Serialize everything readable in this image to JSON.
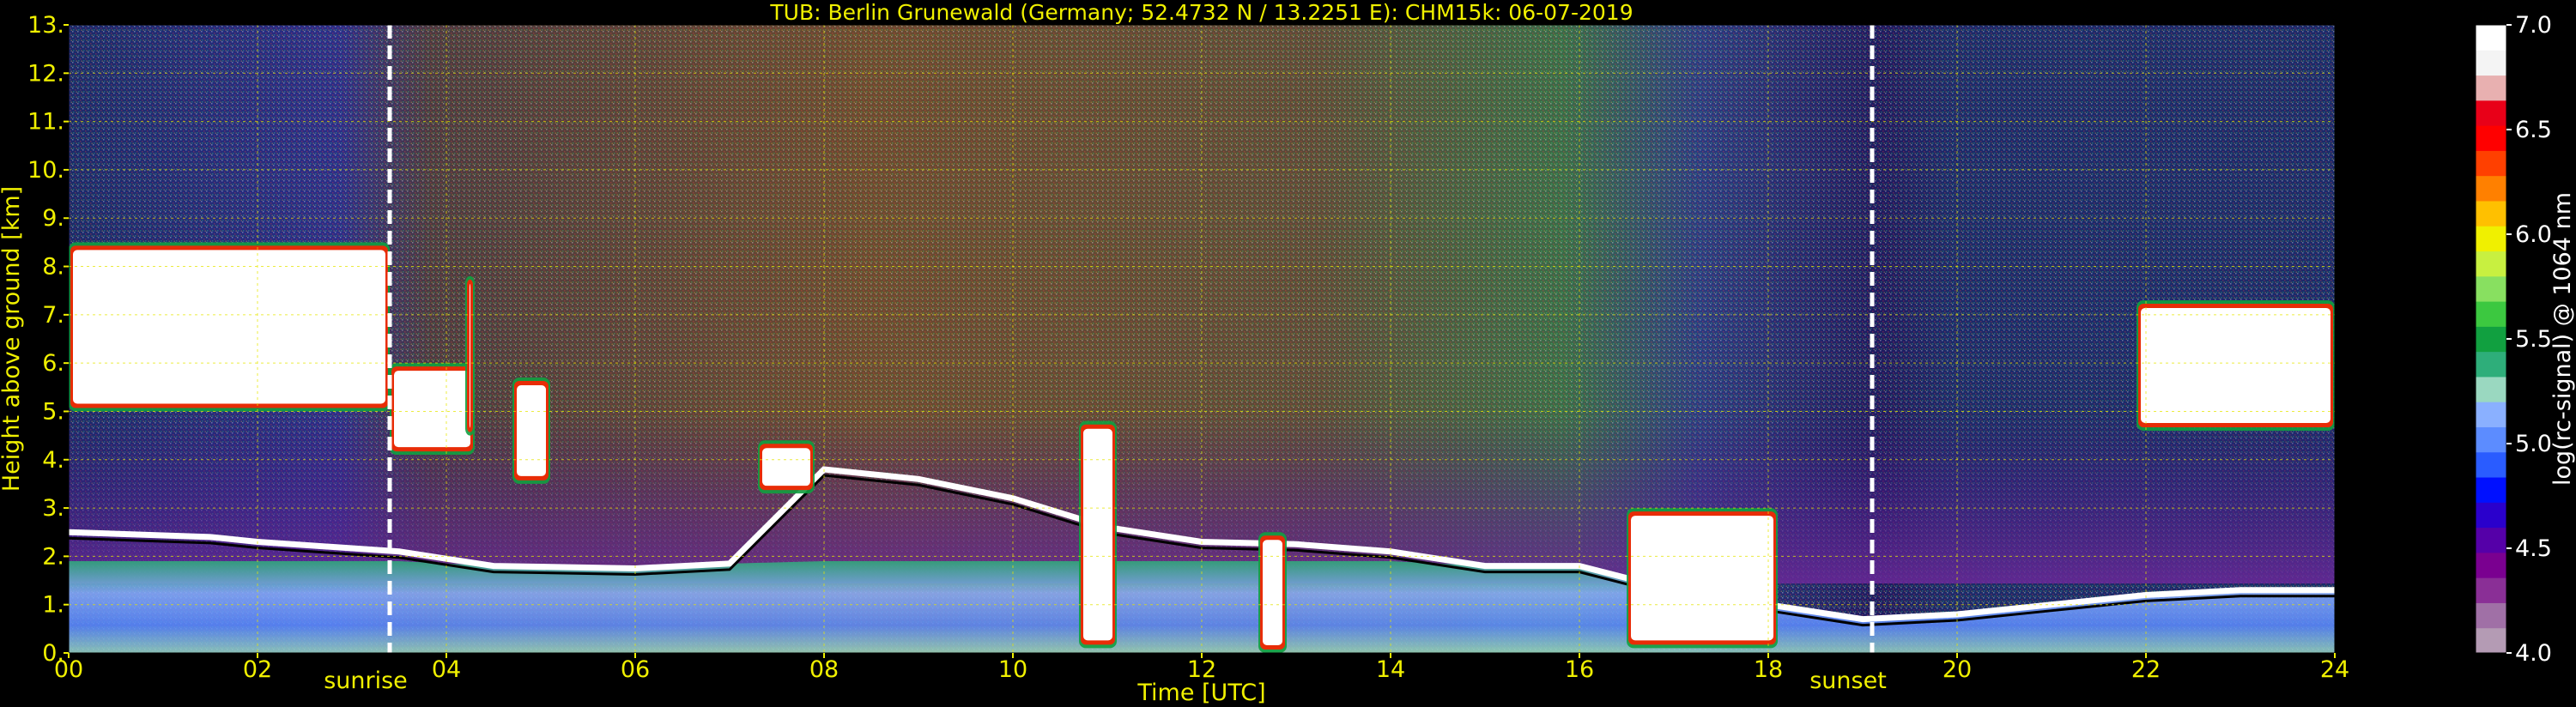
{
  "chart_data": {
    "type": "heatmap",
    "title": "TUB: Berlin Grunewald (Germany; 52.4732 N / 13.2251 E):    CHM15k: 06-07-2019",
    "xlabel": "Time [UTC]",
    "ylabel": "Height above ground [km]",
    "xlim": [
      0,
      24
    ],
    "ylim": [
      0,
      13
    ],
    "x_ticks": [
      "00",
      "02",
      "04",
      "06",
      "08",
      "10",
      "12",
      "14",
      "16",
      "18",
      "20",
      "22",
      "24"
    ],
    "y_ticks": [
      "0.",
      "1.",
      "2.",
      "3.",
      "4.",
      "5.",
      "6.",
      "7.",
      "8.",
      "9.",
      "10.",
      "11.",
      "12.",
      "13."
    ],
    "grid": true,
    "colorbar": {
      "label": "log(rc-signal) @ 1064 nm",
      "range": [
        4.0,
        7.0
      ],
      "ticks": [
        "4.0",
        "4.5",
        "5.0",
        "5.5",
        "6.0",
        "6.5",
        "7.0"
      ],
      "colors": [
        "#b49bb4",
        "#a070a6",
        "#8a2f96",
        "#7a0090",
        "#5500a8",
        "#2a00cc",
        "#0010ff",
        "#2a5cff",
        "#5c8cff",
        "#8ab0ff",
        "#9ad8c0",
        "#2eae7a",
        "#11a040",
        "#3cc840",
        "#88e060",
        "#c8f040",
        "#f0f000",
        "#ffc000",
        "#ff8000",
        "#ff4000",
        "#ff0000",
        "#e80018",
        "#e8b0b0",
        "#f4f4f4",
        "#ffffff"
      ]
    },
    "events": [
      {
        "label": "sunrise",
        "x": 3.4
      },
      {
        "label": "sunset",
        "x": 19.1
      }
    ],
    "cloud_layers": [
      {
        "x_start": 0.0,
        "x_end": 3.4,
        "y_bottom": 5.0,
        "y_top": 8.5,
        "intensity": "high"
      },
      {
        "x_start": 3.4,
        "x_end": 4.3,
        "y_bottom": 4.1,
        "y_top": 6.0,
        "intensity": "high"
      },
      {
        "x_start": 4.2,
        "x_end": 4.3,
        "y_bottom": 4.5,
        "y_top": 7.8,
        "intensity": "high"
      },
      {
        "x_start": 4.7,
        "x_end": 5.1,
        "y_bottom": 3.5,
        "y_top": 5.7,
        "intensity": "high"
      },
      {
        "x_start": 7.3,
        "x_end": 7.9,
        "y_bottom": 3.3,
        "y_top": 4.4,
        "intensity": "high"
      },
      {
        "x_start": 10.7,
        "x_end": 11.1,
        "y_bottom": 0.1,
        "y_top": 4.8,
        "intensity": "high"
      },
      {
        "x_start": 12.6,
        "x_end": 12.9,
        "y_bottom": 0.0,
        "y_top": 2.5,
        "intensity": "high"
      },
      {
        "x_start": 16.5,
        "x_end": 18.1,
        "y_bottom": 0.1,
        "y_top": 3.0,
        "intensity": "high"
      },
      {
        "x_start": 21.9,
        "x_end": 24.0,
        "y_bottom": 4.6,
        "y_top": 7.3,
        "intensity": "high"
      }
    ],
    "boundary_layer": [
      {
        "x": 0.0,
        "y": 2.5
      },
      {
        "x": 1.5,
        "y": 2.4
      },
      {
        "x": 2.0,
        "y": 2.3
      },
      {
        "x": 3.5,
        "y": 2.1
      },
      {
        "x": 4.5,
        "y": 1.8
      },
      {
        "x": 6.0,
        "y": 1.75
      },
      {
        "x": 7.0,
        "y": 1.85
      },
      {
        "x": 8.0,
        "y": 3.8
      },
      {
        "x": 9.0,
        "y": 3.6
      },
      {
        "x": 10.0,
        "y": 3.2
      },
      {
        "x": 11.0,
        "y": 2.6
      },
      {
        "x": 12.0,
        "y": 2.3
      },
      {
        "x": 13.0,
        "y": 2.25
      },
      {
        "x": 14.0,
        "y": 2.1
      },
      {
        "x": 15.0,
        "y": 1.8
      },
      {
        "x": 16.0,
        "y": 1.8
      },
      {
        "x": 17.0,
        "y": 1.3
      },
      {
        "x": 18.0,
        "y": 1.0
      },
      {
        "x": 19.0,
        "y": 0.7
      },
      {
        "x": 20.0,
        "y": 0.8
      },
      {
        "x": 21.0,
        "y": 1.0
      },
      {
        "x": 22.0,
        "y": 1.2
      },
      {
        "x": 23.0,
        "y": 1.3
      },
      {
        "x": 24.0,
        "y": 1.3
      }
    ]
  }
}
